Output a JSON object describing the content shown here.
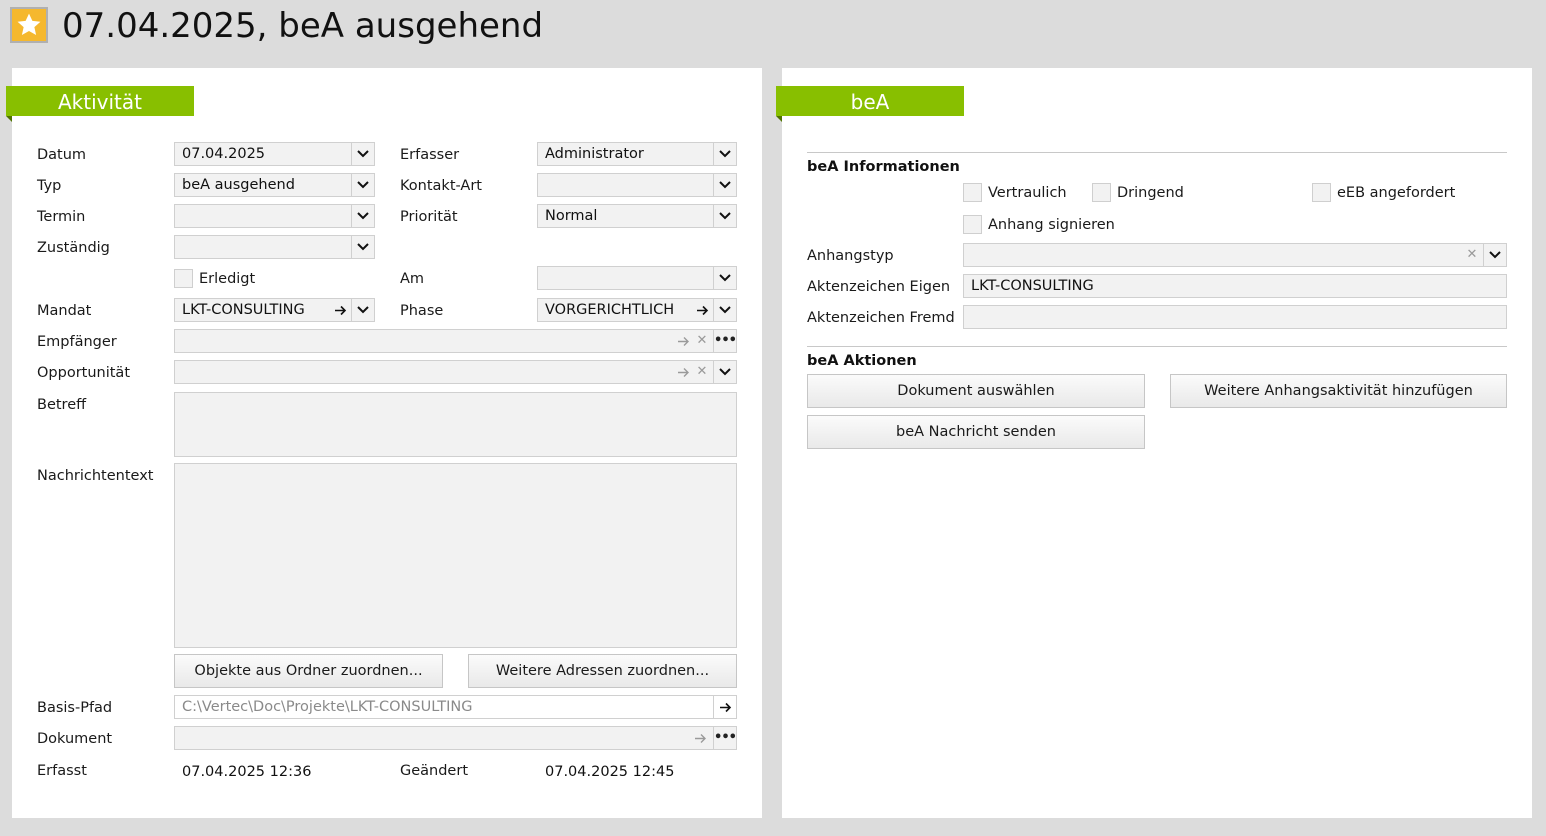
{
  "header": {
    "title": "07.04.2025, beA ausgehend",
    "icon": "star-icon",
    "icon_color": "#f5b82e"
  },
  "aktivitaet": {
    "tab_label": "Aktivität",
    "accent": "#88bf00",
    "datum_label": "Datum",
    "datum_value": "07.04.2025",
    "erfasser_label": "Erfasser",
    "erfasser_value": "Administrator",
    "typ_label": "Typ",
    "typ_value": "beA ausgehend",
    "kontakt_art_label": "Kontakt-Art",
    "kontakt_art_value": "",
    "termin_label": "Termin",
    "termin_value": "",
    "prioritaet_label": "Priorität",
    "prioritaet_value": "Normal",
    "zustaendig_label": "Zuständig",
    "zustaendig_value": "",
    "erledigt_label": "Erledigt",
    "am_label": "Am",
    "am_value": "",
    "mandat_label": "Mandat",
    "mandat_value": "LKT-CONSULTING",
    "phase_label": "Phase",
    "phase_value": "VORGERICHTLICH",
    "empfaenger_label": "Empfänger",
    "empfaenger_value": "",
    "opportunitaet_label": "Opportunität",
    "opportunitaet_value": "",
    "betreff_label": "Betreff",
    "nachrichtentext_label": "Nachrichtentext",
    "btn_objekte": "Objekte aus Ordner zuordnen...",
    "btn_adressen": "Weitere Adressen zuordnen...",
    "basis_pfad_label": "Basis-Pfad",
    "basis_pfad_value": "C:\\Vertec\\Doc\\Projekte\\LKT-CONSULTING",
    "dokument_label": "Dokument",
    "dokument_value": "",
    "erfasst_label": "Erfasst",
    "erfasst_value": "07.04.2025 12:36",
    "geaendert_label": "Geändert",
    "geaendert_value": "07.04.2025 12:45"
  },
  "bea": {
    "tab_label": "beA",
    "info_title": "beA Informationen",
    "vertraulich_label": "Vertraulich",
    "dringend_label": "Dringend",
    "eeb_label": "eEB angefordert",
    "anhang_signieren_label": "Anhang signieren",
    "anhangstyp_label": "Anhangstyp",
    "anhangstyp_value": "",
    "az_eigen_label": "Aktenzeichen Eigen",
    "az_eigen_value": "LKT-CONSULTING",
    "az_fremd_label": "Aktenzeichen Fremd",
    "az_fremd_value": "",
    "aktionen_title": "beA Aktionen",
    "btn_dokument": "Dokument auswählen",
    "btn_weitere": "Weitere Anhangsaktivität hinzufügen",
    "btn_senden": "beA Nachricht senden"
  }
}
